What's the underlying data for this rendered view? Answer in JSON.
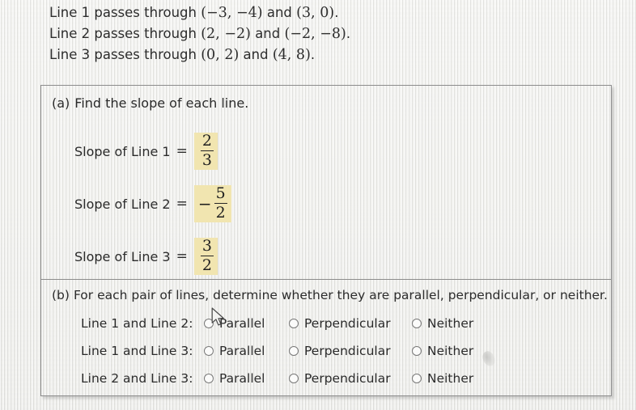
{
  "problem": {
    "statements": [
      {
        "prefix": "Line 1 passes through ",
        "point_a": "(−3, −4)",
        "conj": " and ",
        "point_b": "(3, 0)",
        "suffix": "."
      },
      {
        "prefix": "Line 2 passes through ",
        "point_a": "(2, −2)",
        "conj": " and ",
        "point_b": "(−2, −8)",
        "suffix": "."
      },
      {
        "prefix": "Line 3 passes through ",
        "point_a": "(0, 2)",
        "conj": " and ",
        "point_b": "(4, 8)",
        "suffix": "."
      }
    ]
  },
  "part_a": {
    "tag": "(a)",
    "prompt": "Find the slope of each line.",
    "rows": [
      {
        "label": "Slope of Line 1",
        "equals": "=",
        "answer": {
          "sign": "",
          "numerator": "2",
          "denominator": "3"
        }
      },
      {
        "label": "Slope of Line 2",
        "equals": "=",
        "answer": {
          "sign": "−",
          "numerator": "5",
          "denominator": "2"
        }
      },
      {
        "label": "Slope of Line 3",
        "equals": "=",
        "answer": {
          "sign": "",
          "numerator": "3",
          "denominator": "2"
        }
      }
    ],
    "highlight_color": "#f1e5b0"
  },
  "part_b": {
    "tag": "(b)",
    "prompt": "For each pair of lines, determine whether they are parallel, perpendicular, or neither.",
    "option_labels": {
      "parallel": "Parallel",
      "perpendicular": "Perpendicular",
      "neither": "Neither"
    },
    "rows": [
      {
        "label": "Line 1 and Line 2:",
        "selected": null
      },
      {
        "label": "Line 1 and Line 3:",
        "selected": null
      },
      {
        "label": "Line 2 and Line 3:",
        "selected": null
      }
    ]
  },
  "colors": {
    "page_background": "#ececea",
    "panel_border": "#8c8c8c",
    "text": "#2b2b2b",
    "answer_highlight": "#f1e5b0",
    "radio_border": "#777777"
  }
}
